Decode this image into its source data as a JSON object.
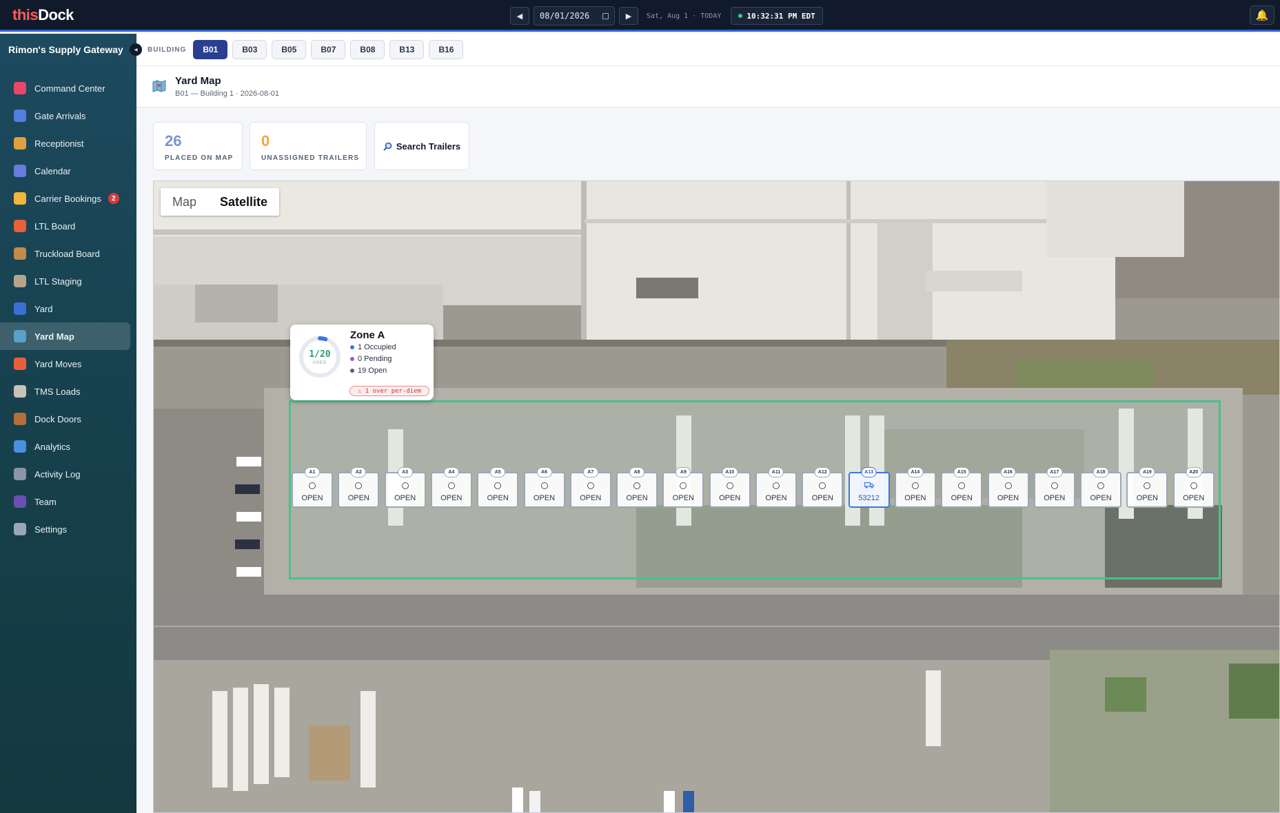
{
  "app": {
    "logo_part1": "this",
    "logo_part2": "Dock",
    "date_value": "08/01/2026",
    "date_label": "Sat, Aug 1 · TODAY",
    "clock": "10:32:31 PM EDT"
  },
  "sidebar": {
    "title": "Rimon's Supply Gateway",
    "items": [
      {
        "label": "Command Center",
        "icon": "target-icon",
        "color": "#e8476b"
      },
      {
        "label": "Gate Arrivals",
        "icon": "gate-icon",
        "color": "#4f7fe0"
      },
      {
        "label": "Receptionist",
        "icon": "service-bell-icon",
        "color": "#e0a13a"
      },
      {
        "label": "Calendar",
        "icon": "calendar-icon",
        "color": "#6a7bdf"
      },
      {
        "label": "Carrier Bookings",
        "icon": "bell-icon",
        "color": "#f2b63a",
        "badge": "2"
      },
      {
        "label": "LTL Board",
        "icon": "truck-icon",
        "color": "#e8603a"
      },
      {
        "label": "Truckload Board",
        "icon": "box-icon",
        "color": "#c38b4a"
      },
      {
        "label": "LTL Staging",
        "icon": "clipboard-icon",
        "color": "#b6a58c"
      },
      {
        "label": "Yard",
        "icon": "parking-icon",
        "color": "#3b6fd6"
      },
      {
        "label": "Yard Map",
        "icon": "map-icon",
        "color": "#5aa0c8"
      },
      {
        "label": "Yard Moves",
        "icon": "truck-icon",
        "color": "#e8603a"
      },
      {
        "label": "TMS Loads",
        "icon": "receipt-icon",
        "color": "#c9c2b6"
      },
      {
        "label": "Dock Doors",
        "icon": "door-icon",
        "color": "#b5703a"
      },
      {
        "label": "Analytics",
        "icon": "bar-chart-icon",
        "color": "#4a8fe0"
      },
      {
        "label": "Activity Log",
        "icon": "clock-icon",
        "color": "#8a96a8"
      },
      {
        "label": "Team",
        "icon": "people-icon",
        "color": "#6b4fb0"
      },
      {
        "label": "Settings",
        "icon": "gear-icon",
        "color": "#9aa6b6"
      }
    ],
    "active_index": 9
  },
  "building": {
    "label": "BUILDING",
    "options": [
      "B01",
      "B03",
      "B05",
      "B07",
      "B08",
      "B13",
      "B16"
    ],
    "selected": "B01"
  },
  "page": {
    "title": "Yard Map",
    "subtitle": "B01 — Building 1 · 2026-08-01"
  },
  "stats": {
    "placed": {
      "value": "26",
      "label": "PLACED ON MAP",
      "color": "#7b93d6"
    },
    "unassigned": {
      "value": "0",
      "label": "UNASSIGNED TRAILERS",
      "color": "#f2a73a"
    },
    "search_label": "Search Trailers"
  },
  "map": {
    "toggle": {
      "map": "Map",
      "satellite": "Satellite",
      "selected": "Satellite"
    }
  },
  "zone": {
    "name": "Zone A",
    "ratio": "1/20",
    "used_label": "USED",
    "used_fraction": 0.05,
    "occupied": "1 Occupied",
    "pending": "0 Pending",
    "open": "19 Open",
    "warning": "⚠ 1 over per-diem",
    "colors": {
      "occupied": "#3b76e3",
      "pending": "#9b59d9",
      "open": "#5a6270"
    }
  },
  "slots": [
    {
      "id": "A1",
      "status": "OPEN"
    },
    {
      "id": "A2",
      "status": "OPEN"
    },
    {
      "id": "A3",
      "status": "OPEN"
    },
    {
      "id": "A4",
      "status": "OPEN"
    },
    {
      "id": "A5",
      "status": "OPEN"
    },
    {
      "id": "A6",
      "status": "OPEN"
    },
    {
      "id": "A7",
      "status": "OPEN"
    },
    {
      "id": "A8",
      "status": "OPEN"
    },
    {
      "id": "A9",
      "status": "OPEN"
    },
    {
      "id": "A10",
      "status": "OPEN"
    },
    {
      "id": "A11",
      "status": "OPEN"
    },
    {
      "id": "A12",
      "status": "OPEN"
    },
    {
      "id": "A13",
      "status": "53212",
      "occupied": true
    },
    {
      "id": "A14",
      "status": "OPEN"
    },
    {
      "id": "A15",
      "status": "OPEN"
    },
    {
      "id": "A16",
      "status": "OPEN"
    },
    {
      "id": "A17",
      "status": "OPEN"
    },
    {
      "id": "A18",
      "status": "OPEN"
    },
    {
      "id": "A19",
      "status": "OPEN"
    },
    {
      "id": "A20",
      "status": "OPEN"
    }
  ]
}
